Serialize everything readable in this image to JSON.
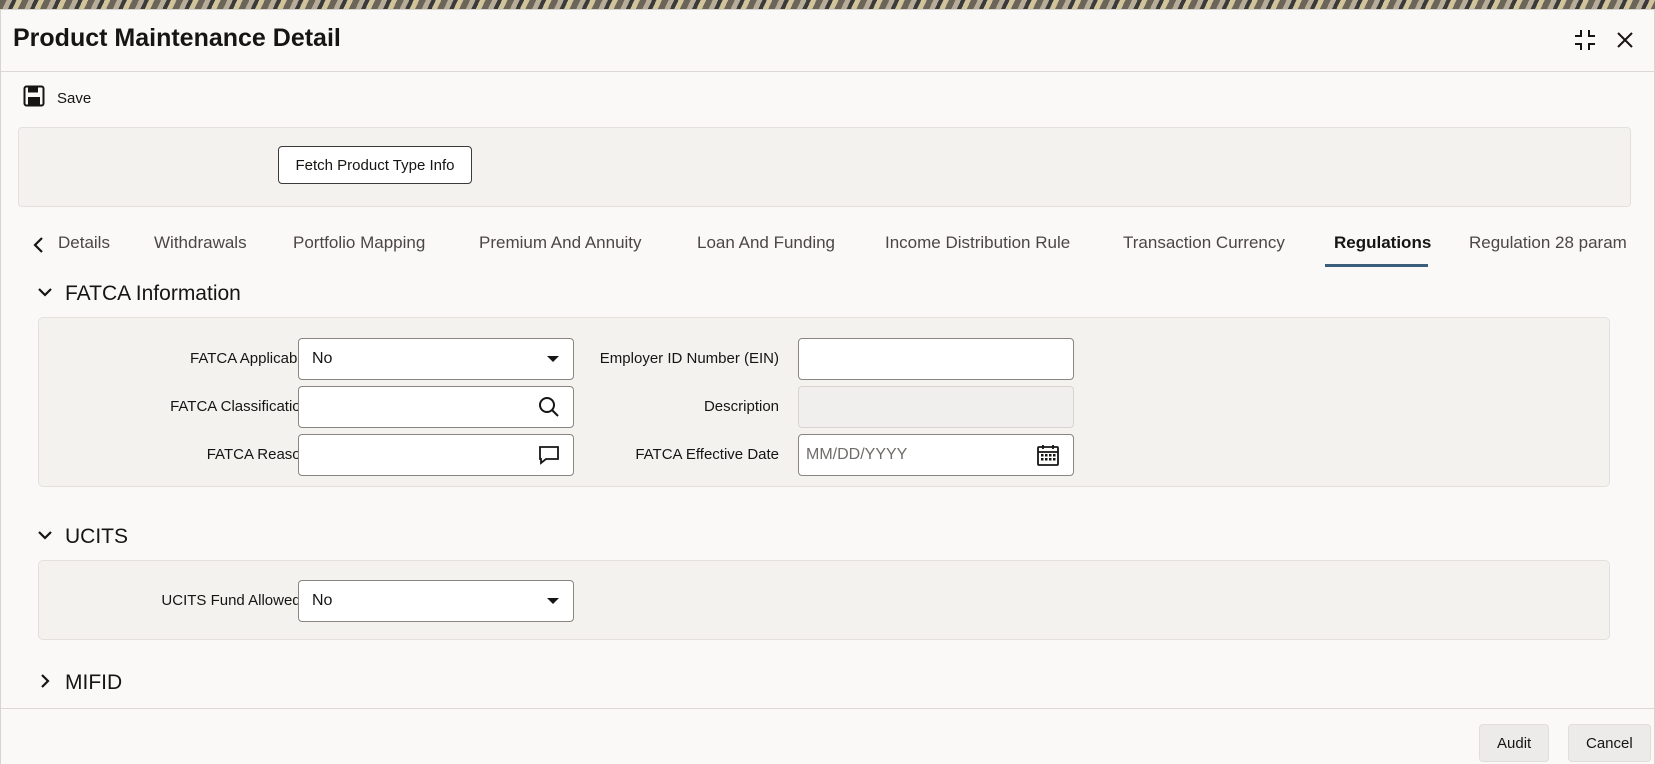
{
  "window": {
    "title": "Product Maintenance Detail"
  },
  "toolbar": {
    "save_label": "Save"
  },
  "header": {
    "fetch_button_label": "Fetch Product Type Info"
  },
  "tabs": [
    {
      "label": "Details",
      "active": false
    },
    {
      "label": "Withdrawals",
      "active": false
    },
    {
      "label": "Portfolio Mapping",
      "active": false
    },
    {
      "label": "Premium And Annuity",
      "active": false
    },
    {
      "label": "Loan And Funding",
      "active": false
    },
    {
      "label": "Income Distribution Rule",
      "active": false
    },
    {
      "label": "Transaction Currency",
      "active": false
    },
    {
      "label": "Regulations",
      "active": true
    },
    {
      "label": "Regulation 28 param",
      "active": false
    }
  ],
  "sections": {
    "fatca": {
      "title": "FATCA Information",
      "expanded": true,
      "fatca_applicable": {
        "label": "FATCA Applicable",
        "value": "No"
      },
      "fatca_classification": {
        "label": "FATCA Classification",
        "value": ""
      },
      "fatca_reason": {
        "label": "FATCA Reason",
        "value": ""
      },
      "employer_id": {
        "label": "Employer ID Number (EIN)",
        "value": ""
      },
      "description": {
        "label": "Description",
        "value": ""
      },
      "effective_date": {
        "label": "FATCA Effective Date",
        "value": "",
        "placeholder": "MM/DD/YYYY"
      }
    },
    "ucits": {
      "title": "UCITS",
      "expanded": true,
      "fund_allowed": {
        "label": "UCITS Fund Allowed?",
        "value": "No"
      }
    },
    "mifid": {
      "title": "MIFID",
      "expanded": false
    }
  },
  "footer": {
    "audit_label": "Audit",
    "cancel_label": "Cancel"
  },
  "icons": {
    "maximize": "maximize-icon",
    "close": "close-icon",
    "save": "floppy-disk-icon",
    "search": "search-icon",
    "comment": "comment-icon",
    "calendar": "calendar-icon",
    "dropdown": "caret-down-icon"
  },
  "colors": {
    "accent_underline": "#3b5f7a",
    "panel_bg": "#f4f2ef"
  }
}
